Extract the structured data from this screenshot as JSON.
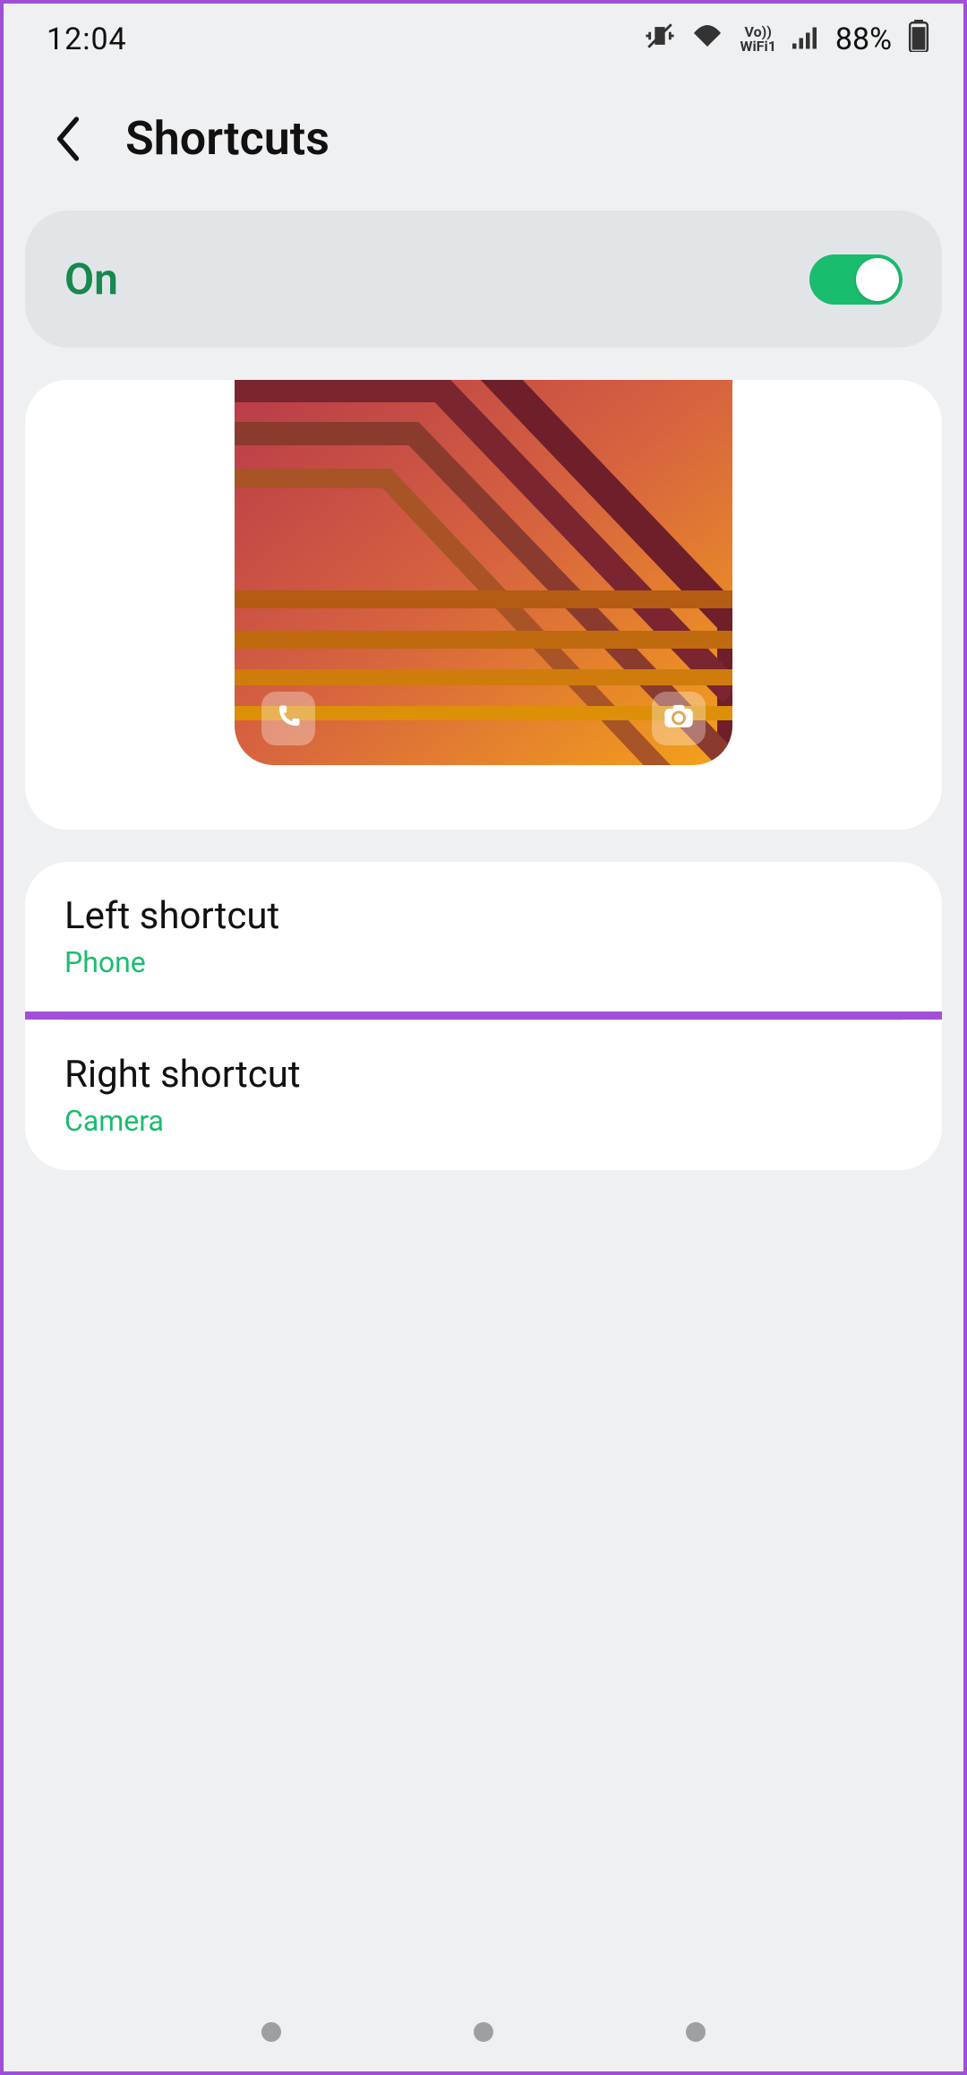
{
  "status": {
    "time": "12:04",
    "vowifi_top": "Vo))",
    "vowifi_bottom": "WiFi1",
    "battery_pct": "88%"
  },
  "header": {
    "title": "Shortcuts"
  },
  "toggle": {
    "label": "On",
    "state": "on"
  },
  "shortcuts": {
    "left": {
      "title": "Left shortcut",
      "value": "Phone"
    },
    "right": {
      "title": "Right shortcut",
      "value": "Camera"
    }
  },
  "colors": {
    "accent_green": "#1abc6e",
    "highlight_purple": "#a24fd8"
  }
}
